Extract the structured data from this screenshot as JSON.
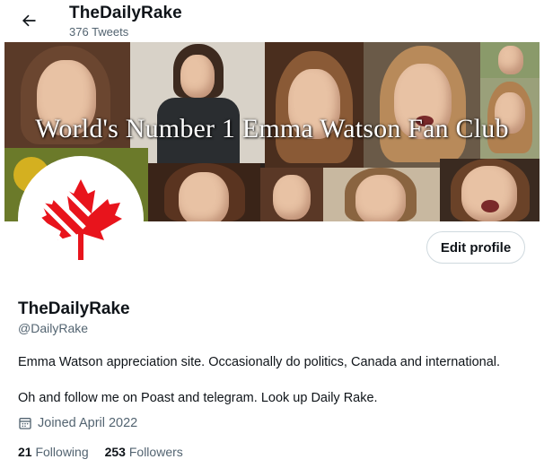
{
  "header": {
    "title": "TheDailyRake",
    "tweet_count": "376 Tweets",
    "back_icon": "arrow-left-icon"
  },
  "banner": {
    "text": "World's Number 1 Emma Watson Fan Club"
  },
  "profile": {
    "edit_button": "Edit profile",
    "display_name": "TheDailyRake",
    "handle": "@DailyRake",
    "bio": "Emma Watson appreciation site. Occasionally do politics, Canada and international.\n\nOh and follow me on Poast and telegram. Look up Daily Rake.",
    "joined": "Joined April 2022",
    "joined_icon": "calendar-icon",
    "following_count": "21",
    "following_label": "Following",
    "followers_count": "253",
    "followers_label": "Followers"
  },
  "colors": {
    "text_primary": "#0f1419",
    "text_secondary": "#536471",
    "button_border": "#cfd9de",
    "logo_red": "#e8141c"
  }
}
